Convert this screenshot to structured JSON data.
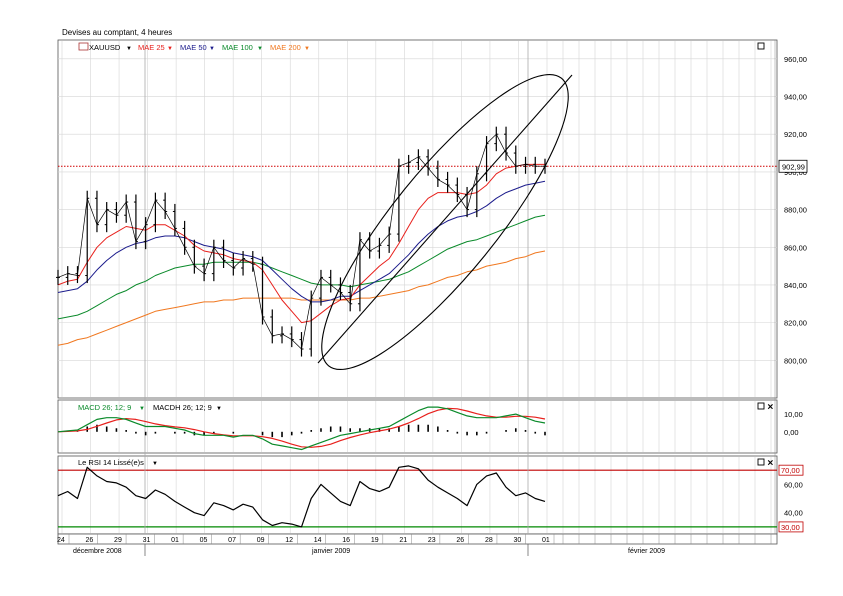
{
  "header": {
    "title": "Devises au comptant, 4 heures"
  },
  "legend": {
    "symbol": "XAUUSD",
    "mae25": "MAE 25",
    "mae50": "MAE 50",
    "mae100": "MAE 100",
    "mae200": "MAE 200",
    "macd": "MACD 26; 12; 9",
    "macdh": "MACDH 26; 12; 9",
    "rsi": "Le RSI 14 Lissé(e)s"
  },
  "colors": {
    "price": "#000000",
    "mae25": "#e8201c",
    "mae50": "#1c1c8c",
    "mae100": "#0a8a2a",
    "mae200": "#f07820",
    "current_price_line": "#d00000",
    "rsi_upper": "#c00000",
    "rsi_lower": "#008800"
  },
  "chart_data": [
    {
      "type": "line",
      "title": "Devises au comptant, 4 heures",
      "ylim": [
        780,
        970
      ],
      "y_ticks": [
        "960,00",
        "940,00",
        "920,00",
        "900,00",
        "880,00",
        "860,00",
        "840,00",
        "820,00",
        "800,00"
      ],
      "current_price_label": "902,99",
      "current_price": 902.99,
      "x_day_labels": [
        "24",
        "26",
        "29",
        "31",
        "01",
        "05",
        "07",
        "09",
        "12",
        "14",
        "16",
        "19",
        "21",
        "23",
        "26",
        "28",
        "30",
        "01"
      ],
      "x_month_labels": [
        "décembre 2008",
        "janvier 2009",
        "février 2009"
      ],
      "x_index": [
        0,
        2,
        4,
        6,
        8,
        10,
        12,
        14,
        16,
        18,
        20,
        22,
        24,
        26,
        28,
        30,
        32,
        34,
        36,
        38,
        40,
        42,
        44,
        46,
        48,
        50,
        52,
        54,
        56,
        58,
        60,
        62,
        64,
        66,
        68,
        70,
        72,
        74,
        76,
        78,
        80,
        82,
        84,
        86,
        88,
        90,
        92,
        94,
        96,
        98,
        100
      ],
      "series": [
        {
          "name": "XAUUSD",
          "values": [
            844,
            846,
            845,
            886,
            872,
            880,
            877,
            884,
            863,
            872,
            885,
            879,
            870,
            860,
            850,
            846,
            860,
            853,
            849,
            854,
            851,
            823,
            813,
            814,
            811,
            806,
            833,
            844,
            840,
            836,
            830,
            864,
            858,
            861,
            867,
            903,
            905,
            908,
            902,
            896,
            893,
            888,
            880,
            899,
            915,
            920,
            910,
            903,
            904,
            903,
            903
          ]
        },
        {
          "name": "MAE 25",
          "values": [
            840,
            842,
            843,
            852,
            860,
            865,
            868,
            871,
            870,
            869,
            872,
            872,
            869,
            866,
            861,
            858,
            857,
            856,
            854,
            853,
            852,
            848,
            840,
            832,
            826,
            820,
            821,
            825,
            829,
            832,
            833,
            840,
            845,
            850,
            854,
            862,
            871,
            880,
            886,
            889,
            889,
            889,
            888,
            889,
            893,
            899,
            902,
            903,
            904,
            904,
            904
          ]
        },
        {
          "name": "MAE 50",
          "values": [
            836,
            837,
            838,
            842,
            848,
            853,
            857,
            860,
            862,
            863,
            865,
            866,
            866,
            865,
            863,
            861,
            860,
            859,
            857,
            856,
            855,
            853,
            848,
            843,
            838,
            834,
            831,
            831,
            832,
            834,
            834,
            837,
            840,
            843,
            846,
            851,
            856,
            862,
            867,
            871,
            874,
            876,
            877,
            879,
            882,
            886,
            889,
            891,
            893,
            894,
            895
          ]
        },
        {
          "name": "MAE 100",
          "values": [
            822,
            823,
            824,
            826,
            829,
            832,
            835,
            837,
            840,
            842,
            845,
            847,
            849,
            850,
            851,
            851,
            852,
            852,
            852,
            852,
            852,
            851,
            849,
            847,
            845,
            843,
            841,
            840,
            840,
            840,
            839,
            840,
            841,
            842,
            843,
            845,
            847,
            850,
            853,
            856,
            859,
            861,
            863,
            864,
            866,
            868,
            870,
            872,
            874,
            876,
            877
          ]
        },
        {
          "name": "MAE 200",
          "values": [
            808,
            809,
            811,
            812,
            814,
            816,
            818,
            820,
            822,
            824,
            826,
            827,
            828,
            829,
            830,
            831,
            831,
            832,
            832,
            833,
            833,
            833,
            833,
            833,
            833,
            832,
            832,
            832,
            832,
            832,
            832,
            833,
            833,
            834,
            835,
            836,
            837,
            839,
            840,
            842,
            844,
            845,
            847,
            848,
            850,
            851,
            852,
            854,
            855,
            857,
            858
          ]
        }
      ]
    },
    {
      "type": "line",
      "title": "MACD 26; 12; 9",
      "ylim": [
        -12,
        18
      ],
      "y_ticks": [
        "10,00",
        "0,00"
      ],
      "series": [
        {
          "name": "MACD",
          "values": [
            0,
            0.5,
            1,
            4,
            7,
            8,
            8,
            7,
            5,
            3,
            3,
            3,
            2,
            1,
            -1,
            -2,
            -2,
            -2,
            -3,
            -2,
            -2,
            -4,
            -7,
            -8,
            -9,
            -10,
            -8,
            -6,
            -4,
            -2,
            -1,
            0,
            1,
            2,
            3,
            6,
            9,
            12,
            14,
            14,
            13,
            11,
            9,
            8,
            8,
            8,
            9,
            10,
            8,
            6,
            5
          ]
        },
        {
          "name": "MACDH",
          "values": [
            0,
            0.5,
            1,
            3,
            4,
            3,
            2,
            1,
            -1,
            -2,
            -1,
            0,
            -1,
            -1,
            -2,
            -2,
            -1,
            0,
            -1,
            0,
            0,
            -2,
            -3,
            -3,
            -2,
            -1,
            1,
            2,
            3,
            3,
            2,
            2,
            2,
            2,
            2,
            3,
            4,
            4,
            4,
            3,
            1,
            -1,
            -2,
            -2,
            -1,
            0,
            1,
            2,
            1,
            -1,
            -2
          ]
        }
      ]
    },
    {
      "type": "line",
      "title": "Le RSI 14 Lissé(e)s",
      "ylim": [
        25,
        80
      ],
      "y_ticks": [
        "60,00",
        "40,00"
      ],
      "upper_label": "70,00",
      "lower_label": "30,00",
      "upper": 70,
      "lower": 30,
      "series": [
        {
          "name": "RSI",
          "values": [
            52,
            55,
            50,
            72,
            66,
            62,
            61,
            58,
            52,
            50,
            56,
            53,
            48,
            44,
            40,
            38,
            47,
            45,
            42,
            46,
            44,
            35,
            31,
            33,
            32,
            30,
            50,
            60,
            54,
            48,
            45,
            62,
            57,
            55,
            58,
            72,
            73,
            71,
            63,
            58,
            54,
            50,
            45,
            60,
            66,
            68,
            58,
            52,
            54,
            50,
            48
          ]
        }
      ]
    }
  ]
}
